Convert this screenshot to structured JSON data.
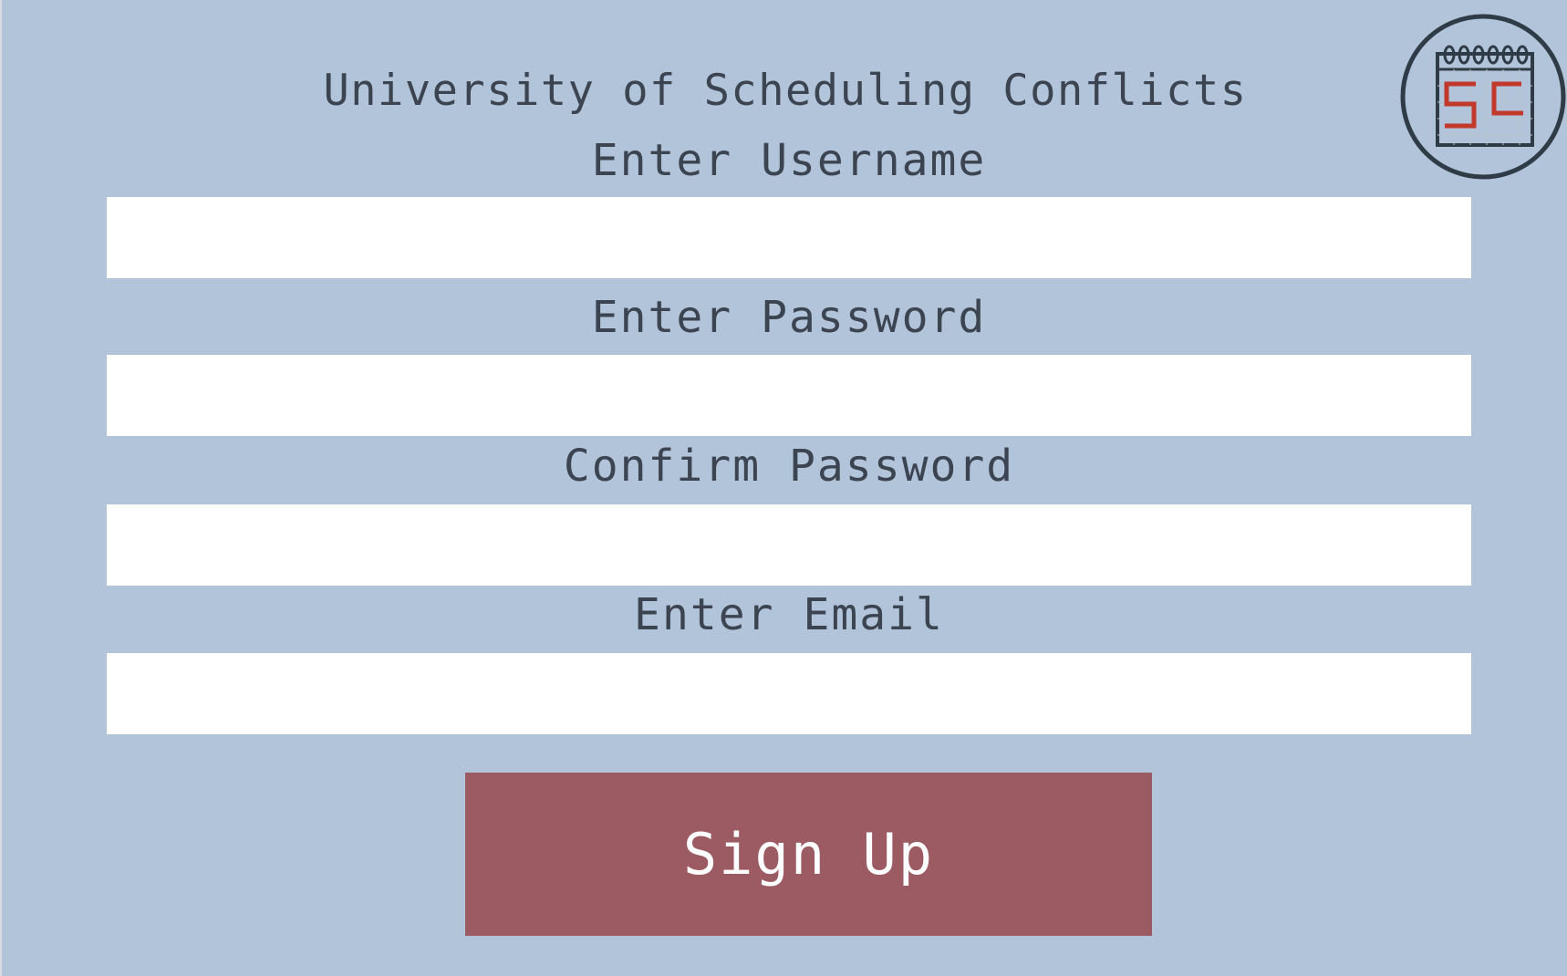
{
  "header": {
    "title": "University of Scheduling Conflicts",
    "logo_icon": "calendar-sc-logo-icon"
  },
  "form": {
    "username_label": "Enter Username",
    "username_value": "",
    "password_label": "Enter Password",
    "password_value": "",
    "confirm_label": "Confirm Password",
    "confirm_value": "",
    "email_label": "Enter Email",
    "email_value": "",
    "submit_label": "Sign Up"
  },
  "colors": {
    "background": "#b1c4d9",
    "field": "#ffffff",
    "button": "#9c5a62",
    "button_text": "#ffffff",
    "text": "#3b4450",
    "logo_outline": "#2f3b46",
    "logo_accent": "#c0392b"
  }
}
